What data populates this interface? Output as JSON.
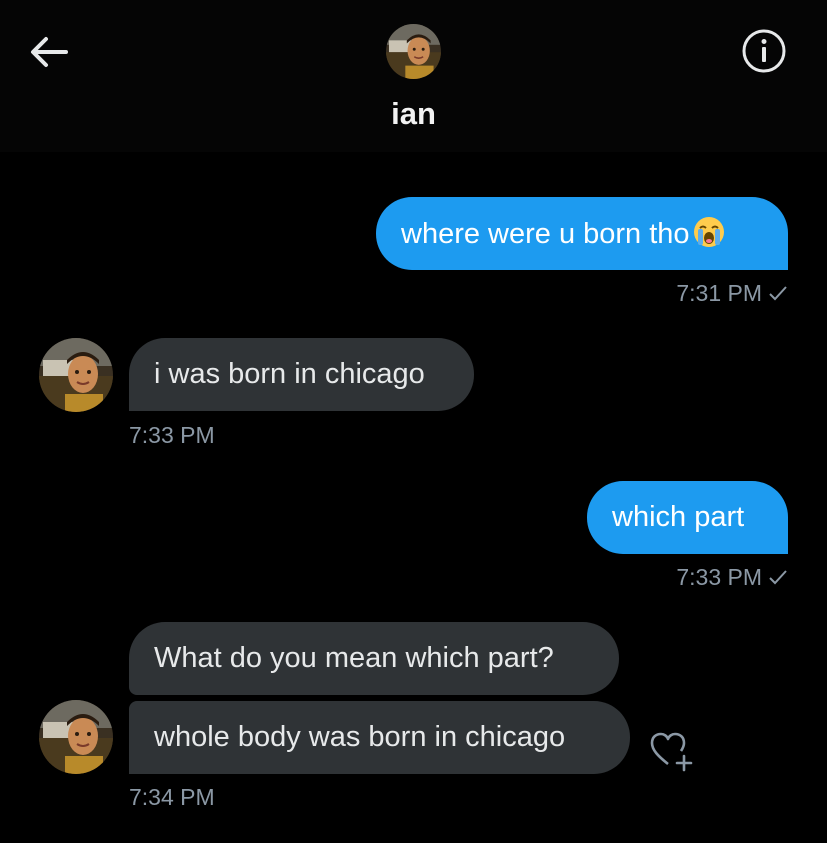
{
  "header": {
    "name": "ian"
  },
  "icons": {
    "back": "arrow-left-icon",
    "info": "info-icon",
    "read": "checkmark-icon",
    "react": "heart-plus-icon",
    "emoji": "loudly-crying-face-emoji"
  },
  "colors": {
    "background": "#000000",
    "outgoing_bubble": "#1d9bf0",
    "incoming_bubble": "#2f3336",
    "timestamp": "#8b98a5"
  },
  "messages": [
    {
      "direction": "outgoing",
      "text": "where were u born tho",
      "emoji": "😭",
      "time": "7:31 PM",
      "read": true
    },
    {
      "direction": "incoming",
      "text": "i was born in chicago",
      "time": "7:33 PM"
    },
    {
      "direction": "outgoing",
      "text": "which part",
      "time": "7:33 PM",
      "read": true
    },
    {
      "direction": "incoming",
      "text": "What do you mean which part?"
    },
    {
      "direction": "incoming",
      "text": "whole body was born in chicago",
      "time": "7:34 PM"
    }
  ]
}
